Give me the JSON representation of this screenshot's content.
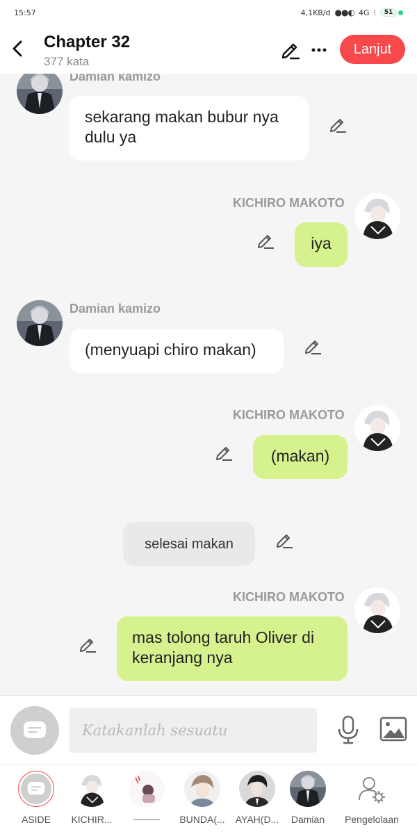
{
  "status_bar": {
    "time": "15:57",
    "network": "4,1KB/d",
    "signal": "4G",
    "battery": "51"
  },
  "header": {
    "title": "Chapter 32",
    "subtitle": "377 kata",
    "continue_label": "Lanjut",
    "accent_color": "#f7494c"
  },
  "messages": [
    {
      "speaker": "Damian kamizo",
      "side": "left",
      "text": "sekarang makan bubur nya dulu ya"
    },
    {
      "speaker": "KICHIRO MAKOTO",
      "side": "right",
      "text": "iya"
    },
    {
      "speaker": "Damian kamizo",
      "side": "left",
      "text": "(menyuapi chiro makan)"
    },
    {
      "speaker": "KICHIRO MAKOTO",
      "side": "right",
      "text": "(makan)"
    },
    {
      "speaker": "",
      "side": "narration",
      "text": "selesai makan"
    },
    {
      "speaker": "KICHIRO MAKOTO",
      "side": "right",
      "text": "mas tolong taruh Oliver di keranjang nya"
    }
  ],
  "composer": {
    "placeholder": "Katakanlah sesuatu",
    "value": ""
  },
  "bottom_nav": {
    "items": [
      {
        "label": "ASIDE",
        "icon": "aside-icon"
      },
      {
        "label": "KICHIR...",
        "icon": "kichiro-avatar"
      },
      {
        "label": "",
        "icon": "character-avatar"
      },
      {
        "label": "BUNDA(...",
        "icon": "bunda-avatar"
      },
      {
        "label": "AYAH(D...",
        "icon": "ayah-avatar"
      },
      {
        "label": "Damian",
        "icon": "damian-avatar"
      },
      {
        "label": "Pengelolaan",
        "icon": "manage-users-icon"
      }
    ]
  },
  "colors": {
    "bubble_left": "#ffffff",
    "bubble_right": "#d5f28e",
    "narration": "#e9e9e9"
  }
}
